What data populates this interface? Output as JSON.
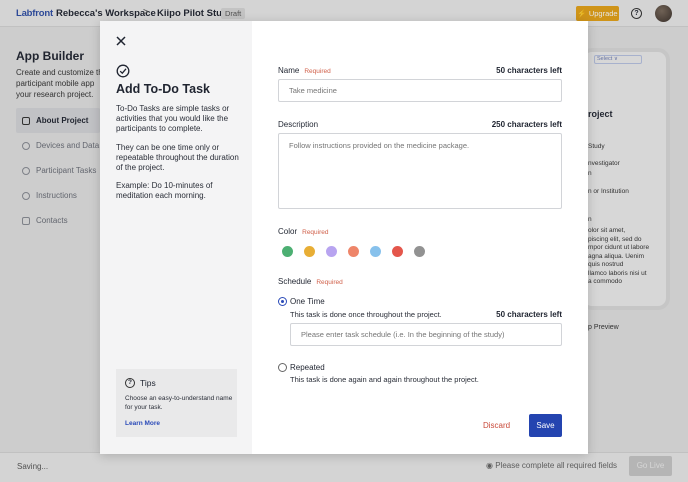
{
  "topbar": {
    "logo": "Labfront",
    "workspace": "Rebecca's Workspace",
    "separator": ">",
    "project": "Kiipo Pilot Study",
    "status_badge": "Draft",
    "upgrade_label": "⚡ Upgrade",
    "help_icon": "question-circle-icon",
    "brand_color": "#2f4fa8",
    "upgrade_color": "#e6a317"
  },
  "app_builder": {
    "title": "App Builder",
    "description_lines": [
      "Create and customize th",
      "participant mobile app",
      "your research project."
    ],
    "nav": [
      {
        "label": "About Project",
        "icon": "document-icon",
        "active": true
      },
      {
        "label": "Devices and Data",
        "icon": "watch-icon"
      },
      {
        "label": "Participant Tasks",
        "icon": "check-circle-icon"
      },
      {
        "label": "Instructions",
        "icon": "info-circle-icon"
      },
      {
        "label": "Contacts",
        "icon": "contact-icon"
      }
    ]
  },
  "phone_preview": {
    "select_label": "Select ∨",
    "title": "roject",
    "lines_a": [
      "Study"
    ],
    "lines_b": [
      "nvestigator",
      "n"
    ],
    "lines_c": [
      "n or Institution"
    ],
    "lines_d": [
      "n"
    ],
    "lorem": [
      "olor sit amet,",
      "piscing elit, sed do",
      "mpor cidunt ut labore",
      "agna aliqua. Uenim",
      "quis nostrud",
      "llamco laboris nisi ut",
      "a commodo"
    ],
    "preview_label": "p Preview"
  },
  "bottombar": {
    "saving": "Saving...",
    "complete_msg": "Please complete all required fields",
    "go_live": "Go Live"
  },
  "modal": {
    "title": "Add To-Do Task",
    "para1": "To-Do Tasks are simple tasks or activities that you would like the participants to complete.",
    "para2": "They can be one time only or repeatable throughout the duration of the project.",
    "para3": "Example: Do 10-minutes of meditation each morning.",
    "tips": {
      "title": "Tips",
      "text": "Choose an easy-to-understand name for your task.",
      "link": "Learn More"
    },
    "name": {
      "label": "Name",
      "required": "Required",
      "count": "50 characters left",
      "placeholder": "Take medicine"
    },
    "description": {
      "label": "Description",
      "count": "250 characters left",
      "placeholder": "Follow instructions provided on the medicine package."
    },
    "color": {
      "label": "Color",
      "required": "Required",
      "swatches": [
        "#4caf72",
        "#e8ae35",
        "#b8a4f0",
        "#ee8569",
        "#87c1ec",
        "#e4564b",
        "#929292"
      ]
    },
    "schedule": {
      "label": "Schedule",
      "required": "Required",
      "one_time": {
        "title": "One Time",
        "desc": "This task is done once throughout the project.",
        "count": "50 characters left",
        "placeholder": "Please enter task schedule (i.e. In the beginning of the study)",
        "selected": true
      },
      "repeated": {
        "title": "Repeated",
        "desc": "This task is done again and again throughout the project.",
        "selected": false
      }
    },
    "discard_label": "Discard",
    "save_label": "Save"
  }
}
